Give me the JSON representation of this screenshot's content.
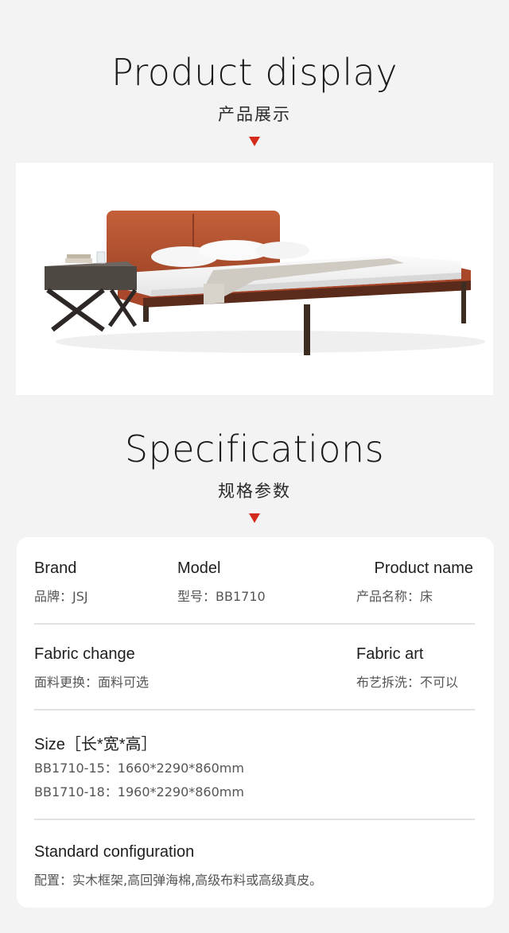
{
  "display": {
    "title": "Product display",
    "subtitle": "产品展示"
  },
  "specs": {
    "title": "Specifications",
    "subtitle": "规格参数",
    "brand": {
      "label": "Brand",
      "value": "品牌：JSJ"
    },
    "model": {
      "label": "Model",
      "value": "型号：BB1710"
    },
    "product_name": {
      "label": "Product name",
      "value": "产品名称：床"
    },
    "fabric_change": {
      "label": "Fabric change",
      "value": "面料更换：面料可选"
    },
    "fabric_art": {
      "label": "Fabric art",
      "value": "布艺拆洗：不可以"
    },
    "size": {
      "label": "Size［长*宽*高］",
      "lines": [
        "BB1710-15：1660*2290*860mm",
        "BB1710-18：1960*2290*860mm"
      ]
    },
    "config": {
      "label": "Standard configuration",
      "value": "配置：实木框架,高回弹海棉,高级布料或高级真皮。"
    }
  },
  "colors": {
    "accent": "#d42a1c",
    "background": "#f3f3f3",
    "leather": "#b5502d"
  }
}
